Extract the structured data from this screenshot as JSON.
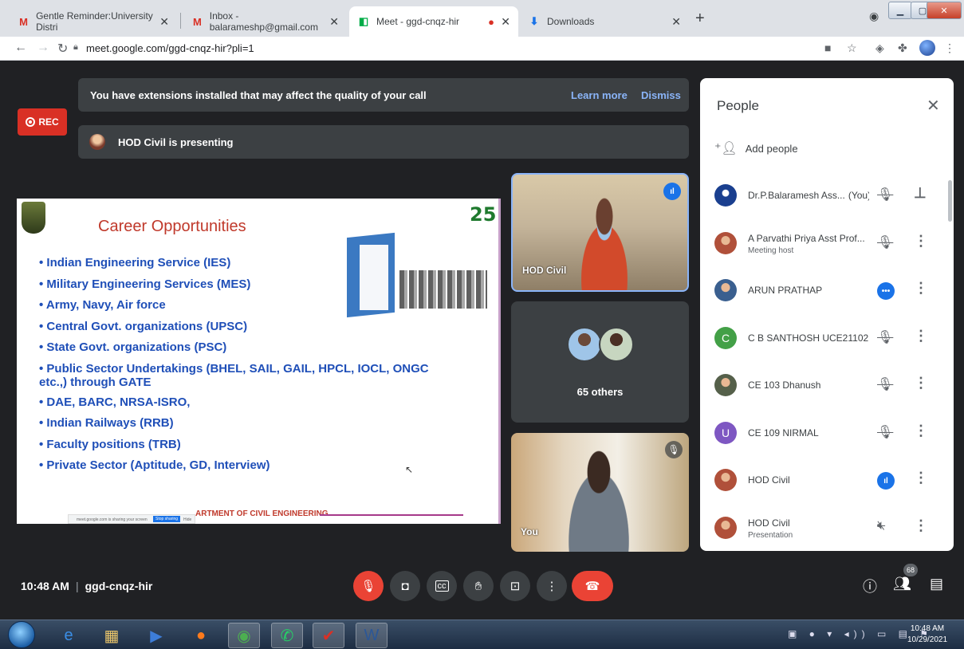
{
  "browser": {
    "tabs": [
      {
        "label": "Gentle Reminder:University Distri",
        "favicon": "M",
        "favicon_color": "#d93025"
      },
      {
        "label": "Inbox - balarameshp@gmail.com",
        "favicon": "M",
        "favicon_color": "#d93025"
      },
      {
        "label": "Meet - ggd-cnqz-hir",
        "favicon": "▮",
        "favicon_color": "#00ac47"
      },
      {
        "label": "Downloads",
        "favicon": "⬇",
        "favicon_color": "#1a73e8"
      }
    ],
    "url": "meet.google.com/ggd-cnqz-hir?pli=1"
  },
  "meet": {
    "rec_label": "REC",
    "extensions_banner": "You have extensions installed that may affect the quality of your call",
    "learn_more": "Learn more",
    "dismiss": "Dismiss",
    "presenting_text": "HOD Civil is presenting",
    "slide": {
      "title": "Career Opportunities",
      "badge": "25",
      "items": [
        "Indian Engineering Service  (IES)",
        "Military Engineering Services (MES)",
        "Army, Navy, Air force",
        "Central Govt. organizations (UPSC)",
        "State Govt. organizations (PSC)",
        "Public Sector Undertakings (BHEL, SAIL, GAIL, HPCL, IOCL, ONGC etc.,) through GATE",
        "DAE, BARC, NRSA-ISRO,",
        "Indian Railways (RRB)",
        "Faculty positions (TRB)",
        "Private Sector (Aptitude, GD, Interview)"
      ],
      "footer": "ARTMENT OF CIVIL ENGINEERING",
      "share_bar_text": "meet.google.com is sharing your screen",
      "stop_sharing": "Stop sharing",
      "hide": "Hide"
    },
    "tiles": {
      "hod_name": "HOD Civil",
      "others_label": "65 others",
      "you_label": "You"
    },
    "bottom": {
      "time": "10:48 AM",
      "separator": "|",
      "code": "ggd-cnqz-hir",
      "participant_count": "68"
    }
  },
  "people_panel": {
    "title": "People",
    "add_people": "Add people",
    "participants": [
      {
        "name": "Dr.P.Balaramesh Ass...",
        "suffix": "(You)",
        "subtitle": "",
        "avatar_type": "logo",
        "avatar_color": "#1a3f8f",
        "mic": "muted",
        "action": "pin"
      },
      {
        "name": "A Parvathi Priya Asst Prof...",
        "suffix": "",
        "subtitle": "Meeting host",
        "avatar_type": "photo",
        "avatar_color": "#b0503a",
        "mic": "muted",
        "action": "more"
      },
      {
        "name": "ARUN PRATHAP",
        "suffix": "",
        "subtitle": "",
        "avatar_type": "photo",
        "avatar_color": "#3a5f8f",
        "mic": "speaking-dots",
        "action": "more"
      },
      {
        "name": "C B SANTHOSH UCE21102",
        "suffix": "",
        "subtitle": "",
        "avatar_type": "letter",
        "avatar_letter": "C",
        "avatar_color": "#43a047",
        "mic": "muted",
        "action": "more"
      },
      {
        "name": "CE 103 Dhanush",
        "suffix": "",
        "subtitle": "",
        "avatar_type": "photo",
        "avatar_color": "#55604a",
        "mic": "muted",
        "action": "more"
      },
      {
        "name": "CE 109 NIRMAL",
        "suffix": "",
        "subtitle": "",
        "avatar_type": "letter",
        "avatar_letter": "U",
        "avatar_color": "#7e57c2",
        "mic": "muted",
        "action": "more"
      },
      {
        "name": "HOD Civil",
        "suffix": "",
        "subtitle": "",
        "avatar_type": "photo",
        "avatar_color": "#b0503a",
        "mic": "speaking",
        "action": "more"
      },
      {
        "name": "HOD Civil",
        "suffix": "",
        "subtitle": "Presentation",
        "avatar_type": "photo",
        "avatar_color": "#b0503a",
        "mic": "presentation-muted",
        "action": "more"
      }
    ]
  },
  "taskbar": {
    "time": "10:48 AM",
    "date": "10/29/2021"
  }
}
